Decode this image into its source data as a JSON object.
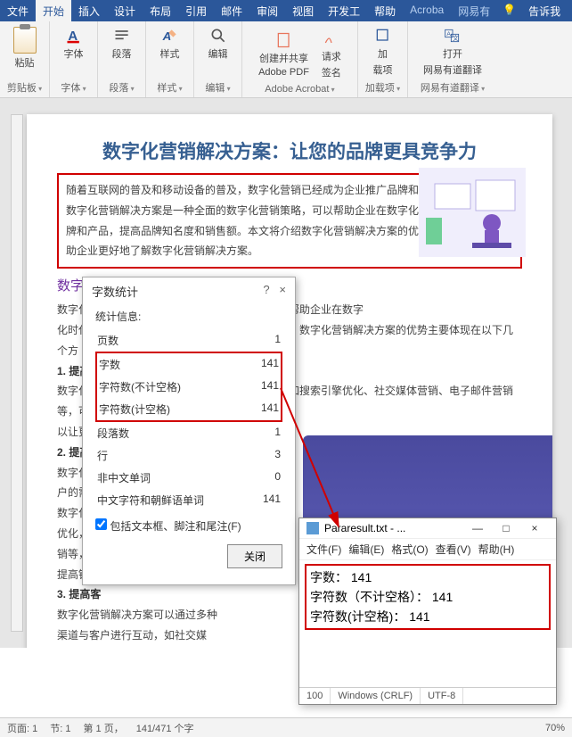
{
  "tabs": {
    "file": "文件",
    "home": "开始",
    "insert": "插入",
    "design": "设计",
    "layout": "布局",
    "ref": "引用",
    "mail": "邮件",
    "review": "审阅",
    "view": "视图",
    "dev": "开发工",
    "help": "帮助",
    "acrobat": "Acroba",
    "netease": "网易有",
    "tell": "告诉我"
  },
  "ribbon": {
    "paste": "粘贴",
    "clipboard": "剪贴板",
    "font": "字体",
    "para": "段落",
    "styles": "样式",
    "edit": "编辑",
    "adobe_create": "创建并共享",
    "adobe_pdf": "Adobe PDF",
    "adobe_sign": "请求",
    "adobe_sign2": "签名",
    "adobe_group": "Adobe Acrobat",
    "addin": "加",
    "addin2": "载项",
    "addin_group": "加载项",
    "open": "打开",
    "netease": "网易有道翻译",
    "netease_group": "网易有道翻译"
  },
  "doc": {
    "title": "数字化营销解决方案：让您的品牌更具竞争力",
    "p1": "随着互联网的普及和移动设备的普及，数字化营销已经成为企业推广品牌和产品的重要手段。数字化营销解决方案是一种全面的数字化营销策略，可以帮助企业在数字化时代更好地推广品牌和产品，提高品牌知名度和销售额。本文将介绍数字化营销解决方案的优势和实施步骤，帮助企业更好地了解数字化营销解决方案。",
    "h2": "数字化",
    "p2a": "数字化营",
    "p2b": "以帮助企业在数字",
    "p3": "化时代更",
    "p3b": "额。数字化营销解决方案的优势主要体现在以下几个方",
    "s1": "1. 提高品",
    "p4": "数字化营",
    "p4b": "，如搜索引擎优化、社交媒体营销、电子邮件营销等，可",
    "p5": "以让更多",
    "s2": "2. 提高销",
    "p6": "数字化营",
    "p7": "户的需求",
    "p8a": "数字化营销解决方案可以通过",
    "p8b": "优化，提高广告投放的效果和",
    "p9": "销等，可",
    "p10": "提高销售",
    "s3": "3. 提高客",
    "p11": "数字化营销解决方案可以通过多种渠道与客户进行互动，如社交媒体、在线客服等，可以及时回答客户的问题，提高客户满意度。"
  },
  "wc": {
    "title": "字数统计",
    "help": "?",
    "close": "×",
    "info": "统计信息:",
    "rows": [
      {
        "k": "页数",
        "v": "1"
      },
      {
        "k": "字数",
        "v": "141"
      },
      {
        "k": "字符数(不计空格)",
        "v": "141"
      },
      {
        "k": "字符数(计空格)",
        "v": "141"
      },
      {
        "k": "段落数",
        "v": "1"
      },
      {
        "k": "行",
        "v": "3"
      },
      {
        "k": "非中文单词",
        "v": "0"
      },
      {
        "k": "中文字符和朝鲜语单词",
        "v": "141"
      }
    ],
    "chk": "包括文本框、脚注和尾注(F)",
    "btn": "关闭"
  },
  "np": {
    "title": "Pararesult.txt - ...",
    "min": "—",
    "max": "□",
    "close": "×",
    "menu": {
      "file": "文件(F)",
      "edit": "编辑(E)",
      "format": "格式(O)",
      "view": "查看(V)",
      "help": "帮助(H)"
    },
    "l1": "字数： 141",
    "l2": "字符数（不计空格）： 141",
    "l3": "字符数(计空格)： 141",
    "st1": "100",
    "st2": "Windows (CRLF)",
    "st3": "UTF-8"
  },
  "status": {
    "page": "页面: 1",
    "sec": "节: 1",
    "pg": "第 1 页，",
    "wc": "141/471 个字",
    "zoom": "70%"
  }
}
